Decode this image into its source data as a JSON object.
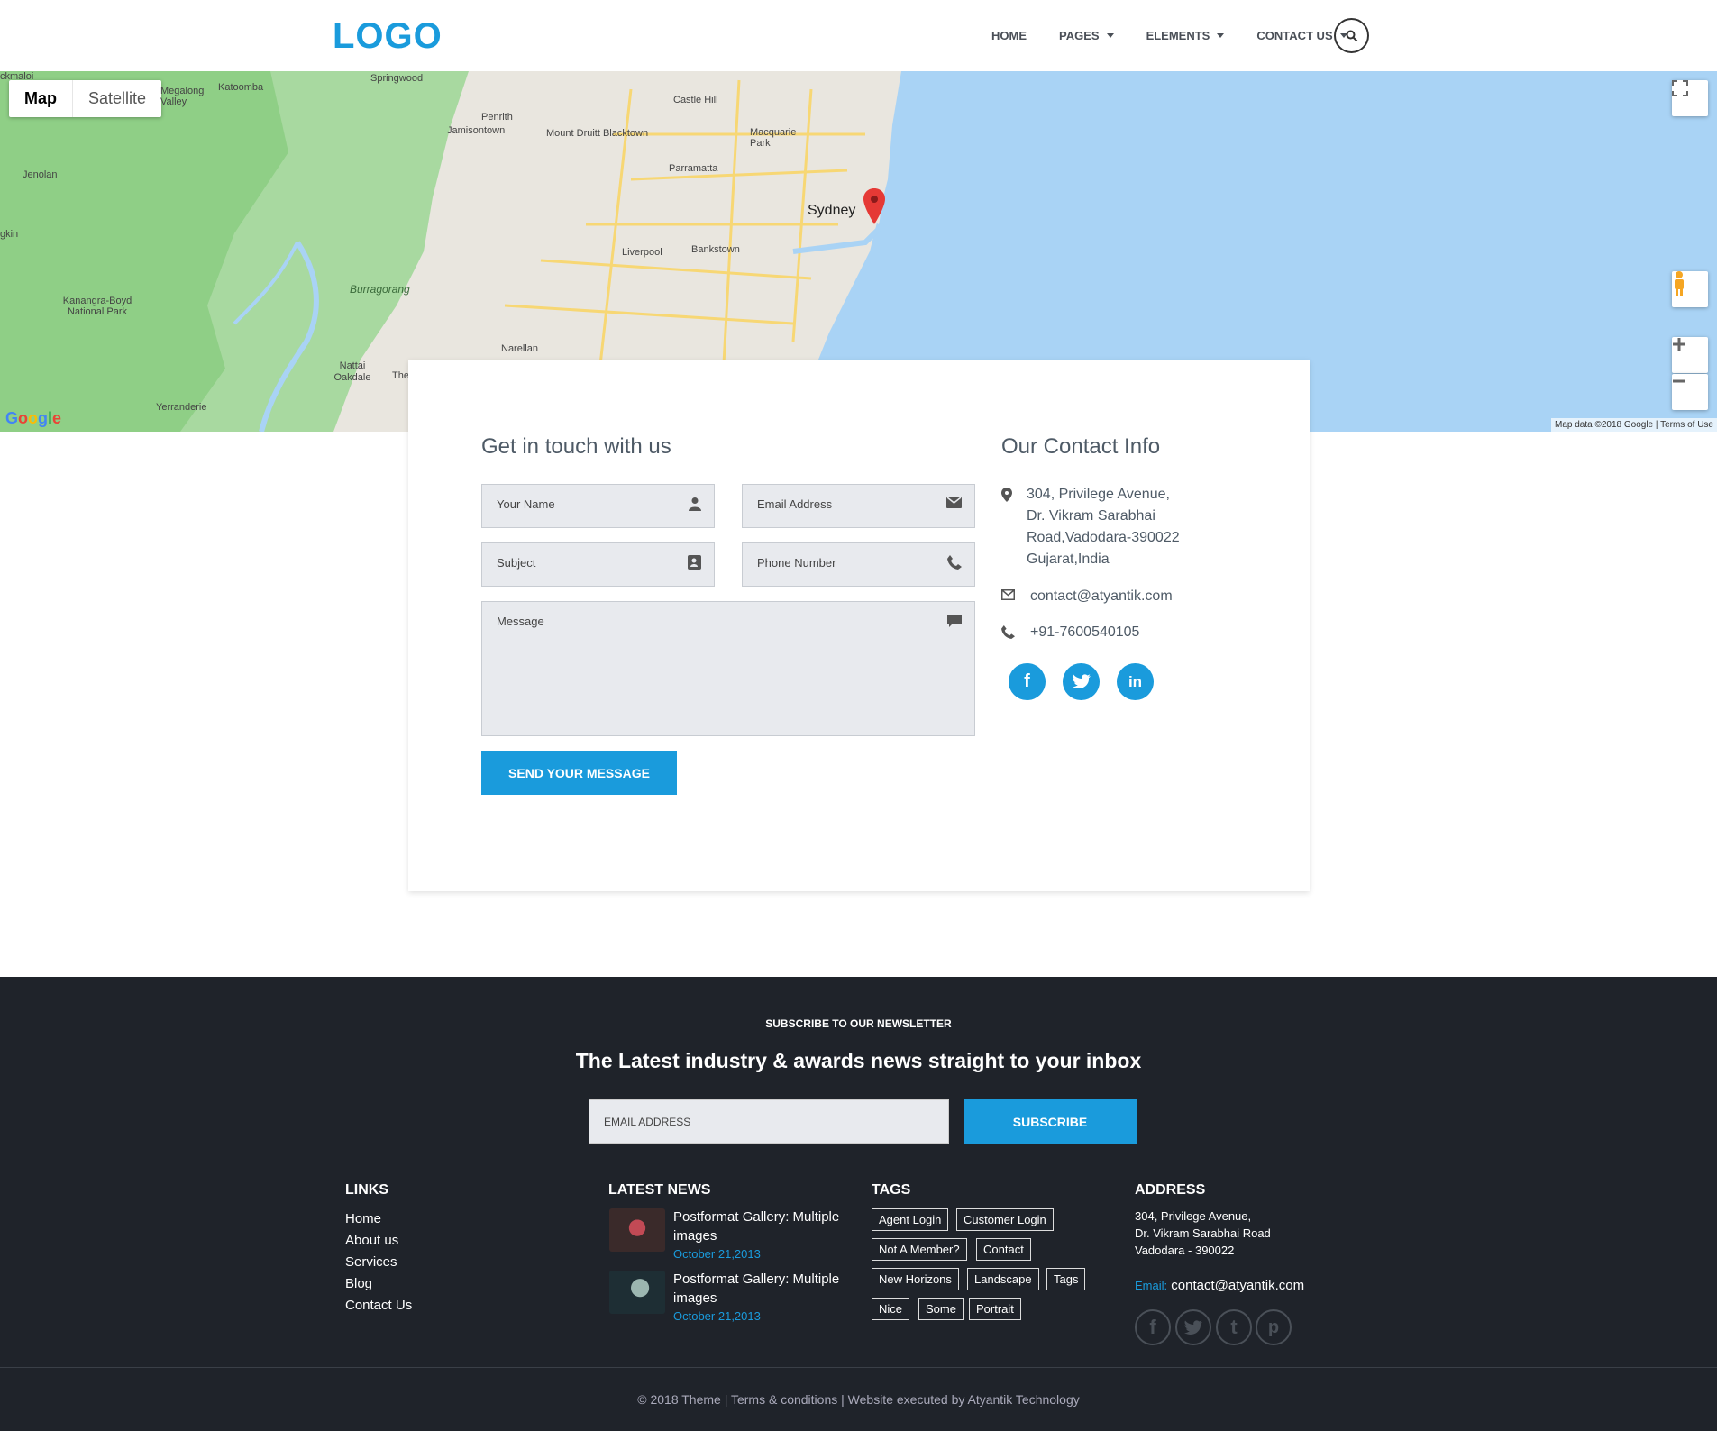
{
  "header": {
    "logo": "LOGO",
    "nav": [
      {
        "label": "HOME"
      },
      {
        "label": "PAGES"
      },
      {
        "label": "ELEMENTS"
      },
      {
        "label": "CONTACT US"
      }
    ]
  },
  "map": {
    "type_map": "Map",
    "type_satellite": "Satellite",
    "labels": {
      "springwood": "Springwood",
      "katoomba": "Katoomba",
      "megalong": "Megalong Valley",
      "penrith": "Penrith",
      "jamisontown": "Jamisontown",
      "castlehill": "Castle Hill",
      "mountdruitt": "Mount Druitt Blacktown",
      "macquarie": "Macquarie Park",
      "parramatta": "Parramatta",
      "sydney": "Sydney",
      "jenolan": "Jenolan",
      "liverpool": "Liverpool",
      "bankstown": "Bankstown",
      "kanangra": "Kanangra-Boyd National Park",
      "burragorang": "Burragorang",
      "narellan": "Narellan",
      "nattai": "Nattai Oakdale",
      "yerranderie": "Yerranderie",
      "ckmaloi": "ckmaloi",
      "gkin": "gkin",
      "the": "The"
    },
    "footer": "Map data ©2018 Google  |  Terms of Use",
    "google": "Google"
  },
  "contact": {
    "form_title": "Get in touch with us",
    "info_title": "Our Contact Info",
    "name_placeholder": "Your Name",
    "email_placeholder": "Email Address",
    "subject_placeholder": "Subject",
    "phone_placeholder": "Phone Number",
    "message_placeholder": "Message",
    "send_label": "SEND YOUR MESSAGE",
    "address_lines": [
      "304, Privilege Avenue,",
      "Dr. Vikram Sarabhai",
      "Road,Vadodara-390022",
      "Gujarat,India"
    ],
    "email": "contact@atyantik.com",
    "phone": "+91-7600540105"
  },
  "footer": {
    "subscribe_label": "SUBSCRIBE TO OUR NEWSLETTER",
    "headline": "The Latest industry & awards news straight to your inbox",
    "email_placeholder": "EMAIL ADDRESS",
    "subscribe_button": "SUBSCRIBE",
    "links_title": "LINKS",
    "links": [
      "Home",
      "About us",
      "Services",
      "Blog",
      "Contact Us"
    ],
    "news_title": "LATEST NEWS",
    "news": [
      {
        "title": "Postformat Gallery: Multiple images",
        "date": "October 21,2013"
      },
      {
        "title": "Postformat Gallery: Multiple images",
        "date": "October 21,2013"
      }
    ],
    "tags_title": "TAGS",
    "tags": [
      "Agent Login",
      "Customer Login",
      "Not A Member?",
      "Contact",
      "New Horizons",
      "Landscape",
      "Tags",
      "Nice",
      "Some",
      "Portrait"
    ],
    "address_title": "ADDRESS",
    "address_lines": [
      "304, Privilege Avenue,",
      "Dr. Vikram Sarabhai Road",
      "Vadodara - 390022"
    ],
    "email_label": "Email:",
    "email": "contact@atyantik.com",
    "copyright": "© 2018 Theme | Terms & conditions | Website executed by Atyantik Technology"
  },
  "colors": {
    "accent": "#1a9bdc",
    "footer_bg": "#1f232a",
    "water": "#a9d3f5"
  }
}
